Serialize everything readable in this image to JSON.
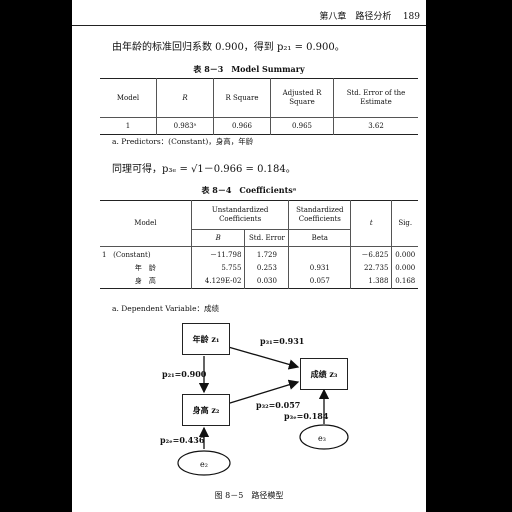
{
  "header": {
    "chapter": "第八章　路径分析",
    "page_number": "189"
  },
  "para1": "由年龄的标准回归系数 0.900，得到 p₂₁ = 0.900。",
  "table1": {
    "title": "表 8－3　Model Summary",
    "headers": [
      "Model",
      "R",
      "R Square",
      "Adjusted R Square",
      "Std. Error of the Estimate"
    ],
    "row": [
      "1",
      "0.983ᵃ",
      "0.966",
      "0.965",
      "3.62"
    ],
    "note": "a. Predictors：(Constant)，身高，年龄"
  },
  "para2": "同理可得，p₃ₑ = √1－0.966 = 0.184。",
  "table2": {
    "title": "表 8－4　Coefficientsᵃ",
    "col_model": "Model",
    "col_unstd": "Unstandardized Coefficients",
    "col_std": "Standardized Coefficients",
    "col_t": "t",
    "col_sig": "Sig.",
    "sub_b": "B",
    "sub_se": "Std. Error",
    "sub_beta": "Beta",
    "rows": [
      {
        "num": "1",
        "name": "(Constant)",
        "b": "－11.798",
        "se": "1.729",
        "beta": "",
        "t": "－6.825",
        "sig": "0.000"
      },
      {
        "num": "",
        "name": "年　龄",
        "b": "5.755",
        "se": "0.253",
        "beta": "0.931",
        "t": "22.735",
        "sig": "0.000"
      },
      {
        "num": "",
        "name": "身　高",
        "b": "4.129E-02",
        "se": "0.030",
        "beta": "0.057",
        "t": "1.388",
        "sig": "0.168"
      }
    ],
    "note": "a. Dependent Variable：成绩"
  },
  "diagram": {
    "node_age": "年龄 z₁",
    "node_height": "身高 z₂",
    "node_score": "成绩 z₃",
    "node_e2": "e₂",
    "node_e3": "e₃",
    "path_p21": "p₂₁=0.900",
    "path_p31": "p₃₁=0.931",
    "path_p32": "p₃₂=0.057",
    "path_p3e": "p₃ₑ=0.184",
    "path_p2e": "p₂ₑ=0.436"
  },
  "caption": "图 8－5　路径模型"
}
